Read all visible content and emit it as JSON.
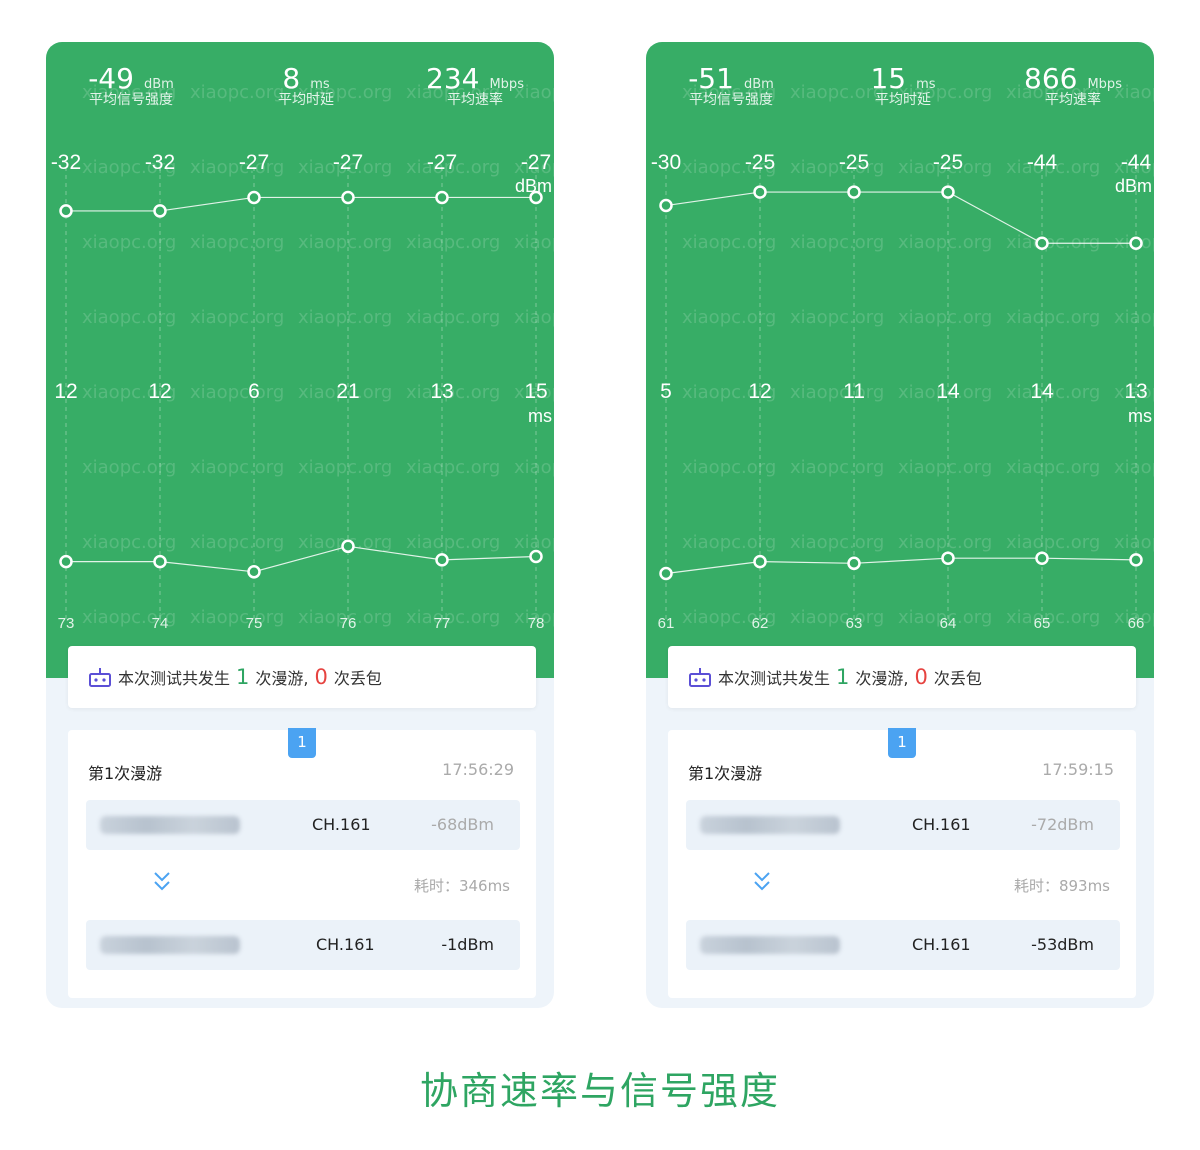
{
  "panels": [
    {
      "stats": [
        {
          "value": "-49",
          "unit": "dBm",
          "label": "平均信号强度"
        },
        {
          "value": "8",
          "unit": "ms",
          "label": "平均时延"
        },
        {
          "value": "234",
          "unit": "Mbps",
          "label": "平均速率"
        }
      ],
      "signal": {
        "values": [
          -32,
          -32,
          -27,
          -27,
          -27,
          -27
        ],
        "unit": "dBm"
      },
      "latency": {
        "values": [
          12,
          12,
          6,
          21,
          13,
          15
        ],
        "unit": "ms"
      },
      "x_labels": [
        "73",
        "74",
        "75",
        "76",
        "77",
        "78"
      ],
      "summary": {
        "prefix": "本次测试共发生",
        "roam_count": "1",
        "roam_label": "次漫游,",
        "loss_count": "0",
        "loss_label": "次丢包"
      },
      "roam": {
        "badge": "1",
        "title": "第1次漫游",
        "time": "17:56:29",
        "from": {
          "channel": "CH.161",
          "signal": "-68dBm"
        },
        "elapsed": "耗时：346ms",
        "to": {
          "channel": "CH.161",
          "signal": "-1dBm"
        }
      }
    },
    {
      "stats": [
        {
          "value": "-51",
          "unit": "dBm",
          "label": "平均信号强度"
        },
        {
          "value": "15",
          "unit": "ms",
          "label": "平均时延"
        },
        {
          "value": "866",
          "unit": "Mbps",
          "label": "平均速率"
        }
      ],
      "signal": {
        "values": [
          -30,
          -25,
          -25,
          -25,
          -44,
          -44
        ],
        "unit": "dBm"
      },
      "latency": {
        "values": [
          5,
          12,
          11,
          14,
          14,
          13
        ],
        "unit": "ms"
      },
      "x_labels": [
        "61",
        "62",
        "63",
        "64",
        "65",
        "66"
      ],
      "summary": {
        "prefix": "本次测试共发生",
        "roam_count": "1",
        "roam_label": "次漫游,",
        "loss_count": "0",
        "loss_label": "次丢包"
      },
      "roam": {
        "badge": "1",
        "title": "第1次漫游",
        "time": "17:59:15",
        "from": {
          "channel": "CH.161",
          "signal": "-72dBm"
        },
        "elapsed": "耗时：893ms",
        "to": {
          "channel": "CH.161",
          "signal": "-53dBm"
        }
      }
    }
  ],
  "watermark": "xiaopc.org",
  "caption": "协商速率与信号强度",
  "colors": {
    "green": "#37ad66",
    "caption": "#2ea562",
    "red": "#e64340",
    "badge": "#4ba3f2"
  }
}
